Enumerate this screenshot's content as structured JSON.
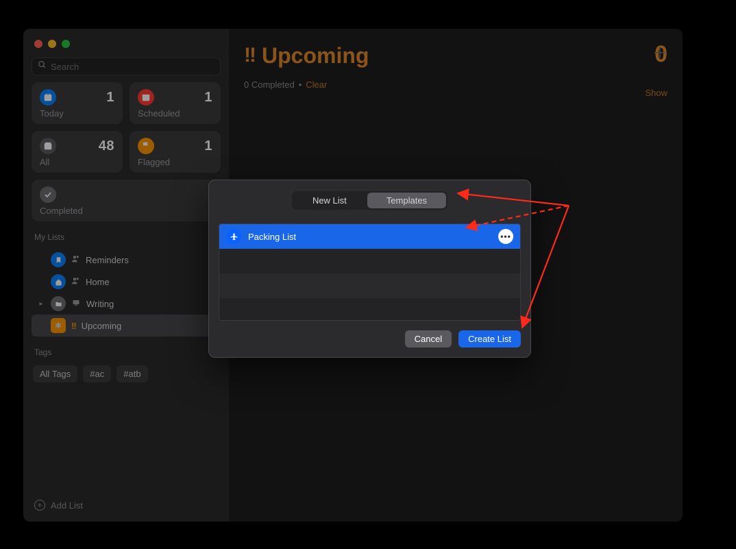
{
  "sidebar": {
    "search_placeholder": "Search",
    "cards": {
      "today": {
        "label": "Today",
        "count": "1"
      },
      "scheduled": {
        "label": "Scheduled",
        "count": "1"
      },
      "all": {
        "label": "All",
        "count": "48"
      },
      "flagged": {
        "label": "Flagged",
        "count": "1"
      },
      "completed": {
        "label": "Completed"
      }
    },
    "section_my_lists": "My Lists",
    "lists": {
      "reminders": {
        "label": "Reminders"
      },
      "home": {
        "label": "Home"
      },
      "writing": {
        "label": "Writing"
      },
      "upcoming": {
        "label": "Upcoming"
      }
    },
    "section_tags": "Tags",
    "tags": {
      "all": "All Tags",
      "ac": "#ac",
      "atb": "#atb"
    },
    "add_list": "Add List"
  },
  "main": {
    "title": "Upcoming",
    "count": "0",
    "completed_text": "0 Completed",
    "separator": "•",
    "clear": "Clear",
    "show": "Show"
  },
  "modal": {
    "tab_new_list": "New List",
    "tab_templates": "Templates",
    "templates": {
      "packing_list": "Packing List"
    },
    "cancel": "Cancel",
    "create": "Create List"
  }
}
